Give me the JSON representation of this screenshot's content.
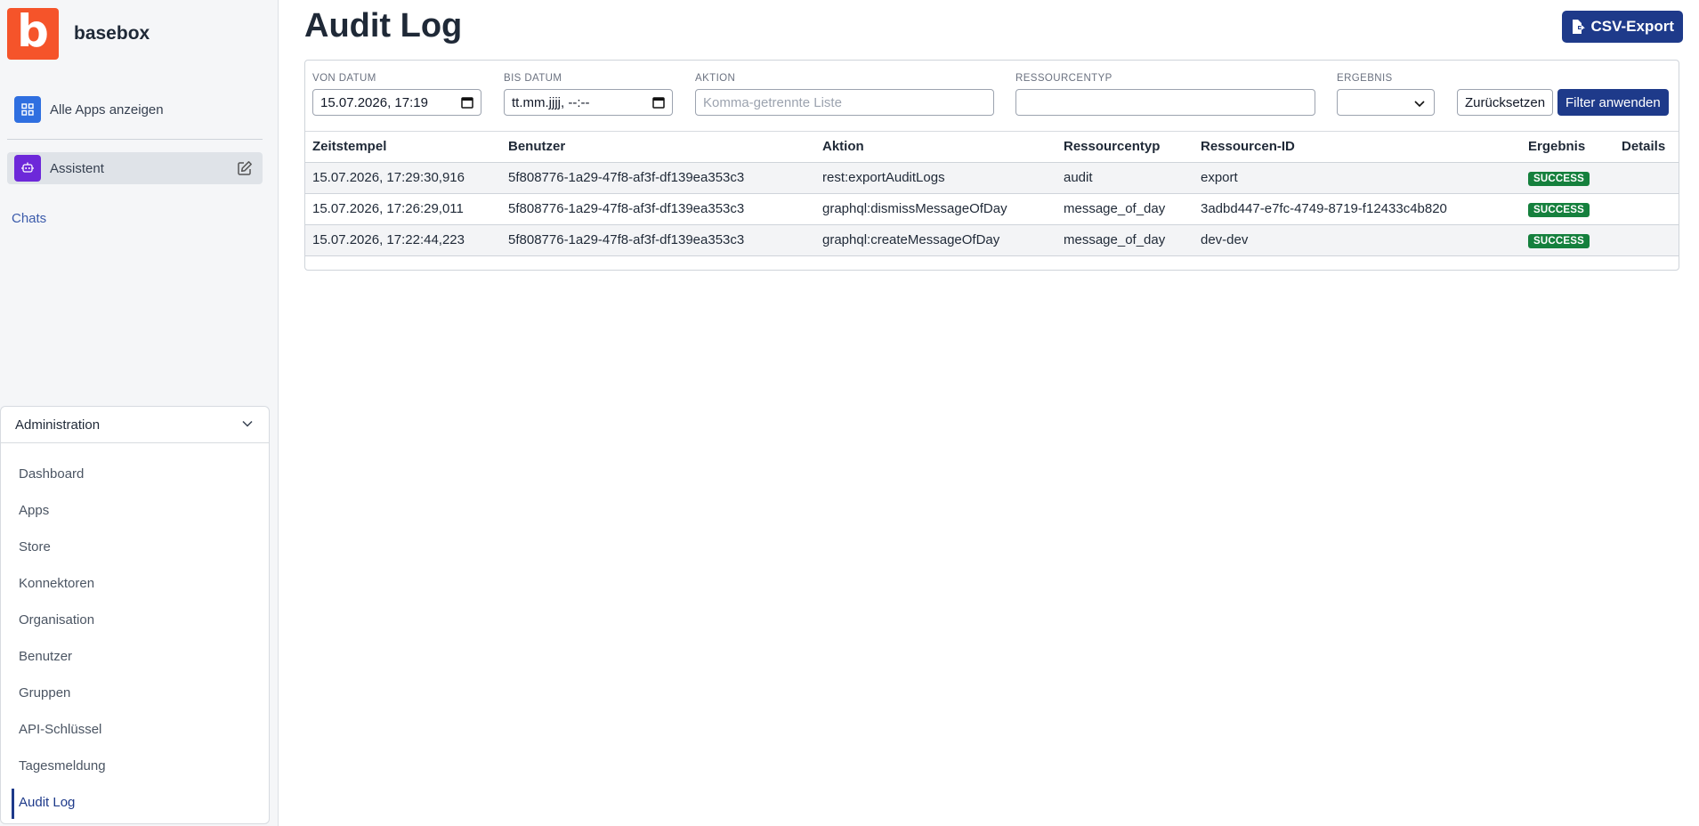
{
  "app": {
    "logo_letter": "b",
    "brand": "basebox"
  },
  "sidebar": {
    "all_apps_label": "Alle Apps anzeigen",
    "assistant_label": "Assistent",
    "chats_label": "Chats",
    "admin": {
      "title": "Administration",
      "items": [
        {
          "label": "Dashboard"
        },
        {
          "label": "Apps"
        },
        {
          "label": "Store"
        },
        {
          "label": "Konnektoren"
        },
        {
          "label": "Organisation"
        },
        {
          "label": "Benutzer"
        },
        {
          "label": "Gruppen"
        },
        {
          "label": "API-Schlüssel"
        },
        {
          "label": "Tagesmeldung"
        },
        {
          "label": "Audit Log",
          "active": true
        }
      ]
    }
  },
  "page": {
    "title": "Audit Log",
    "csv_export_label": "CSV-Export"
  },
  "filters": {
    "from_label": "VON DATUM",
    "from_value": "15.07.2026, 17:19",
    "to_label": "BIS DATUM",
    "to_value": "tt.mm.jjjj, --:--",
    "action_label": "AKTION",
    "action_placeholder": "Komma-getrennte Liste",
    "resource_type_label": "RESSOURCENTYP",
    "resource_type_value": "",
    "result_label": "ERGEBNIS",
    "result_value": "",
    "reset_label": "Zurücksetzen",
    "apply_label": "Filter anwenden"
  },
  "table": {
    "headers": [
      "Zeitstempel",
      "Benutzer",
      "Aktion",
      "Ressourcentyp",
      "Ressourcen-ID",
      "Ergebnis",
      "Details"
    ],
    "rows": [
      [
        "15.07.2026, 17:29:30,916",
        "5f808776-1a29-47f8-af3f-df139ea353c3",
        "rest:exportAuditLogs",
        "audit",
        "export",
        "SUCCESS",
        ""
      ],
      [
        "15.07.2026, 17:26:29,011",
        "5f808776-1a29-47f8-af3f-df139ea353c3",
        "graphql:dismissMessageOfDay",
        "message_of_day",
        "3adbd447-e7fc-4749-8719-f12433c4b820",
        "SUCCESS",
        ""
      ],
      [
        "15.07.2026, 17:22:44,223",
        "5f808776-1a29-47f8-af3f-df139ea353c3",
        "graphql:createMessageOfDay",
        "message_of_day",
        "dev-dev",
        "SUCCESS",
        ""
      ]
    ]
  },
  "colors": {
    "accent": "#1e3a8a",
    "brand": "#f5542a",
    "success": "#15803d"
  },
  "icons": [
    "grid-icon",
    "assistant-icon",
    "edit-icon",
    "chevron-down-icon",
    "calendar-icon",
    "file-export-icon"
  ]
}
